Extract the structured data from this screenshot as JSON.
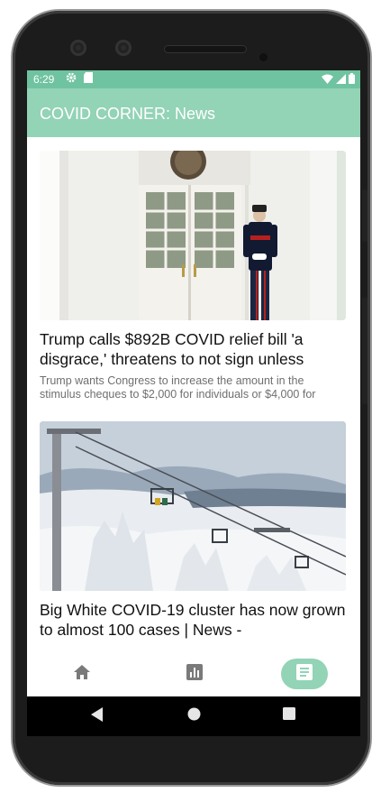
{
  "status_bar": {
    "time": "6:29"
  },
  "app_bar": {
    "title": "COVID CORNER: News"
  },
  "articles": [
    {
      "headline": "Trump calls $892B COVID relief bill 'a disgrace,' threatens to not sign unless",
      "summary": "Trump wants Congress to increase the amount in the stimulus cheques to $2,000 for individuals or $4,000 for"
    },
    {
      "headline": "Big White COVID-19 cluster has now grown to almost 100 cases | News -",
      "summary": ""
    }
  ],
  "bottom_nav": {
    "items": [
      {
        "icon": "home-icon",
        "selected": false
      },
      {
        "icon": "bar-chart-icon",
        "selected": false
      },
      {
        "icon": "article-icon",
        "selected": true
      }
    ]
  },
  "colors": {
    "status_bar": "#6fc3a0",
    "app_bar": "#93d3b6",
    "nav_selected": "#93d3b6",
    "nav_icon": "#7a7a7a"
  }
}
